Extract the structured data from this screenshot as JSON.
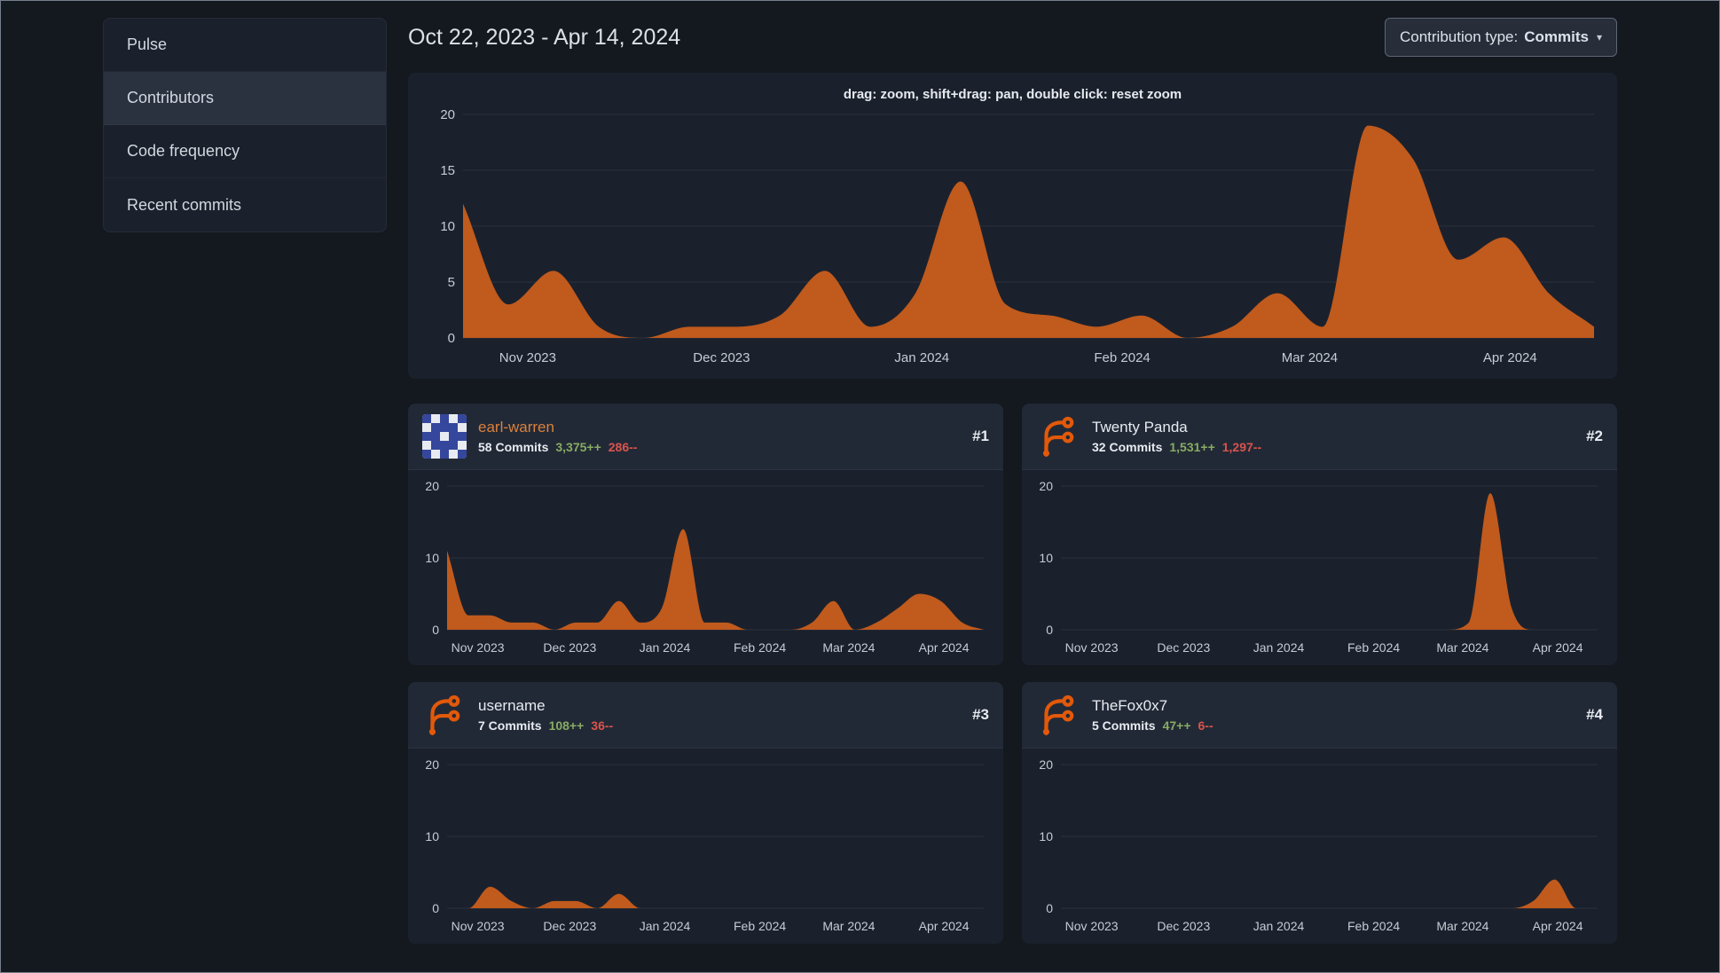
{
  "header": {
    "date_range": "Oct 22, 2023 - Apr 14, 2024",
    "contribution_type_label": "Contribution type:",
    "contribution_type_value": "Commits",
    "caret_icon": "▾"
  },
  "sidebar": {
    "items": [
      {
        "label": "Pulse",
        "active": false
      },
      {
        "label": "Contributors",
        "active": true
      },
      {
        "label": "Code frequency",
        "active": false
      },
      {
        "label": "Recent commits",
        "active": false
      }
    ]
  },
  "contributors": [
    {
      "rank": "#1",
      "name": "earl-warren",
      "commits": "58 Commits",
      "additions": "3,375++",
      "deletions": "286--",
      "avatar": "identicon"
    },
    {
      "rank": "#2",
      "name": "Twenty Panda",
      "commits": "32 Commits",
      "additions": "1,531++",
      "deletions": "1,297--",
      "avatar": "forgejo-logo"
    },
    {
      "rank": "#3",
      "name": "username",
      "commits": "7 Commits",
      "additions": "108++",
      "deletions": "36--",
      "avatar": "forgejo-logo"
    },
    {
      "rank": "#4",
      "name": "TheFox0x7",
      "commits": "5 Commits",
      "additions": "47++",
      "deletions": "6--",
      "avatar": "forgejo-logo"
    }
  ],
  "colors": {
    "page_background": "#14181f",
    "card_background": "#1b212c",
    "card_header_background": "#222936",
    "sidebar_active_background": "#2a3240",
    "chart_fill_orange": "#c05a1d",
    "grid_line": "#2b313c",
    "axis_text": "#c6ccd5",
    "additions_green": "#87ab63",
    "deletions_red": "#d9544d",
    "link_orange": "#d9823e",
    "text_primary": "#dde2e9",
    "logo_orange": "#e2590a",
    "identicon_blue": "#35479c"
  },
  "chart_data": [
    {
      "id": "total",
      "type": "area",
      "hint": "drag: zoom, shift+drag: pan, double click: reset zoom",
      "color": "#c05a1d",
      "ylim": [
        0,
        20
      ],
      "yticks": [
        0,
        5,
        10,
        15,
        20
      ],
      "x_start": "2023-10-22",
      "x_end": "2024-04-14",
      "x_labels": [
        {
          "label": "Nov 2023",
          "date": "2023-11-01"
        },
        {
          "label": "Dec 2023",
          "date": "2023-12-01"
        },
        {
          "label": "Jan 2024",
          "date": "2024-01-01"
        },
        {
          "label": "Feb 2024",
          "date": "2024-02-01"
        },
        {
          "label": "Mar 2024",
          "date": "2024-03-01"
        },
        {
          "label": "Apr 2024",
          "date": "2024-04-01"
        }
      ],
      "unit": "commits per week",
      "values": [
        12,
        3,
        6,
        1,
        0,
        1,
        1,
        2,
        6,
        1,
        4,
        14,
        3,
        2,
        1,
        2,
        0,
        1,
        4,
        1,
        19,
        16,
        7,
        9,
        4,
        1
      ]
    },
    {
      "id": "earl-warren",
      "type": "area",
      "color": "#c05a1d",
      "ylim": [
        0,
        20
      ],
      "yticks": [
        0,
        10,
        20
      ],
      "x_start": "2023-10-22",
      "x_end": "2024-04-14",
      "x_labels": [
        {
          "label": "Nov 2023",
          "date": "2023-11-01"
        },
        {
          "label": "Dec 2023",
          "date": "2023-12-01"
        },
        {
          "label": "Jan 2024",
          "date": "2024-01-01"
        },
        {
          "label": "Feb 2024",
          "date": "2024-02-01"
        },
        {
          "label": "Mar 2024",
          "date": "2024-03-01"
        },
        {
          "label": "Apr 2024",
          "date": "2024-04-01"
        }
      ],
      "unit": "commits per week",
      "values": [
        11,
        2,
        2,
        1,
        1,
        0,
        1,
        1,
        4,
        1,
        3,
        14,
        1,
        1,
        0,
        0,
        0,
        1,
        4,
        0,
        1,
        3,
        5,
        4,
        1,
        0
      ]
    },
    {
      "id": "twenty-panda",
      "type": "area",
      "color": "#c05a1d",
      "ylim": [
        0,
        20
      ],
      "yticks": [
        0,
        10,
        20
      ],
      "x_start": "2023-10-22",
      "x_end": "2024-04-14",
      "x_labels": [
        {
          "label": "Nov 2023",
          "date": "2023-11-01"
        },
        {
          "label": "Dec 2023",
          "date": "2023-12-01"
        },
        {
          "label": "Jan 2024",
          "date": "2024-01-01"
        },
        {
          "label": "Feb 2024",
          "date": "2024-02-01"
        },
        {
          "label": "Mar 2024",
          "date": "2024-03-01"
        },
        {
          "label": "Apr 2024",
          "date": "2024-04-01"
        }
      ],
      "unit": "commits per week",
      "values": [
        0,
        0,
        0,
        0,
        0,
        0,
        0,
        0,
        0,
        0,
        0,
        0,
        0,
        0,
        0,
        0,
        0,
        0,
        0,
        1,
        19,
        3,
        0,
        0,
        0,
        0
      ]
    },
    {
      "id": "username",
      "type": "area",
      "color": "#c05a1d",
      "ylim": [
        0,
        20
      ],
      "yticks": [
        0,
        10,
        20
      ],
      "x_start": "2023-10-22",
      "x_end": "2024-04-14",
      "x_labels": [
        {
          "label": "Nov 2023",
          "date": "2023-11-01"
        },
        {
          "label": "Dec 2023",
          "date": "2023-12-01"
        },
        {
          "label": "Jan 2024",
          "date": "2024-01-01"
        },
        {
          "label": "Feb 2024",
          "date": "2024-02-01"
        },
        {
          "label": "Mar 2024",
          "date": "2024-03-01"
        },
        {
          "label": "Apr 2024",
          "date": "2024-04-01"
        }
      ],
      "unit": "commits per week",
      "values": [
        0,
        0,
        3,
        1,
        0,
        1,
        1,
        0,
        2,
        0,
        0,
        0,
        0,
        0,
        0,
        0,
        0,
        0,
        0,
        0,
        0,
        0,
        0,
        0,
        0,
        0
      ]
    },
    {
      "id": "thefox0x7",
      "type": "area",
      "color": "#c05a1d",
      "ylim": [
        0,
        20
      ],
      "yticks": [
        0,
        10,
        20
      ],
      "x_start": "2023-10-22",
      "x_end": "2024-04-14",
      "x_labels": [
        {
          "label": "Nov 2023",
          "date": "2023-11-01"
        },
        {
          "label": "Dec 2023",
          "date": "2023-12-01"
        },
        {
          "label": "Jan 2024",
          "date": "2024-01-01"
        },
        {
          "label": "Feb 2024",
          "date": "2024-02-01"
        },
        {
          "label": "Mar 2024",
          "date": "2024-03-01"
        },
        {
          "label": "Apr 2024",
          "date": "2024-04-01"
        }
      ],
      "unit": "commits per week",
      "values": [
        0,
        0,
        0,
        0,
        0,
        0,
        0,
        0,
        0,
        0,
        0,
        0,
        0,
        0,
        0,
        0,
        0,
        0,
        0,
        0,
        0,
        0,
        1,
        4,
        0,
        0
      ]
    }
  ]
}
